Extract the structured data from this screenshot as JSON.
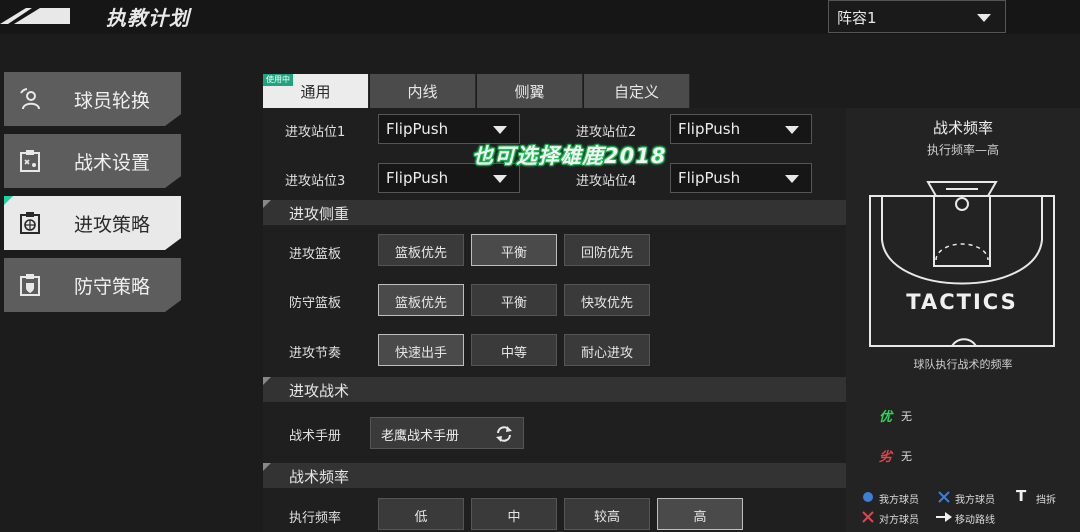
{
  "header": {
    "title": "执教计划",
    "lineup_select": "阵容1"
  },
  "sidebar": {
    "items": [
      {
        "label": "球员轮换",
        "icon": "player-swap-icon"
      },
      {
        "label": "战术设置",
        "icon": "tactic-board-icon"
      },
      {
        "label": "进攻策略",
        "icon": "offense-basketball-icon",
        "active": true
      },
      {
        "label": "防守策略",
        "icon": "defense-shield-icon"
      }
    ]
  },
  "tabs": {
    "in_use_badge": "使用中",
    "items": [
      {
        "label": "通用",
        "active": true
      },
      {
        "label": "内线"
      },
      {
        "label": "侧翼"
      },
      {
        "label": "自定义"
      }
    ]
  },
  "positions": [
    {
      "label": "进攻站位1",
      "value": "FlipPush"
    },
    {
      "label": "进攻站位2",
      "value": "FlipPush"
    },
    {
      "label": "进攻站位3",
      "value": "FlipPush"
    },
    {
      "label": "进攻站位4",
      "value": "FlipPush"
    }
  ],
  "watermark": "也可选择雄鹿2018",
  "sections": {
    "offense_focus": "进攻侧重",
    "offense_tactics": "进攻战术",
    "tactic_frequency": "战术频率"
  },
  "rows": {
    "offensive_rebound": {
      "label": "进攻篮板",
      "options": [
        "篮板优先",
        "平衡",
        "回防优先"
      ],
      "selected": 1
    },
    "defensive_rebound": {
      "label": "防守篮板",
      "options": [
        "篮板优先",
        "平衡",
        "快攻优先"
      ],
      "selected": 0
    },
    "tempo": {
      "label": "进攻节奏",
      "options": [
        "快速出手",
        "中等",
        "耐心进攻"
      ],
      "selected": 0
    },
    "frequency": {
      "label": "执行频率",
      "options": [
        "低",
        "中",
        "较高",
        "高"
      ],
      "selected": 3
    }
  },
  "playbook": {
    "label": "战术手册",
    "value": "老鹰战术手册"
  },
  "right_panel": {
    "title": "战术频率",
    "subtitle": "执行频率—高",
    "court_text": "TACTICS",
    "caption": "球队执行战术的频率",
    "advantage": {
      "icon": "优",
      "text": "无"
    },
    "disadvantage": {
      "icon": "劣",
      "text": "无"
    },
    "legend": [
      {
        "icon": "blue-dot",
        "text": "我方球员"
      },
      {
        "icon": "blue-x",
        "text": "我方球员"
      },
      {
        "icon": "T",
        "text": "挡拆"
      },
      {
        "icon": "red-x",
        "text": "对方球员"
      },
      {
        "icon": "white-arrow",
        "text": "移动路线"
      }
    ]
  },
  "colors": {
    "accent": "#1fd3a6",
    "advantage": "#2fd35a",
    "disadvantage": "#e0454e",
    "our_player": "#3b7fd6"
  }
}
